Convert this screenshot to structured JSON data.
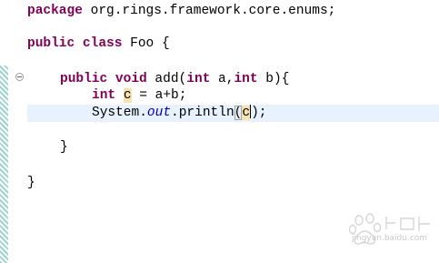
{
  "editor": {
    "language": "java",
    "lines": {
      "package_kw": "package",
      "package_name": " org.rings.framework.core.enums;",
      "class_public": "public",
      "class_kw": "class",
      "class_name": " Foo {",
      "method_public": "public",
      "method_void": "void",
      "method_sig1": " add(",
      "param_int1": "int",
      "method_sig2": " a,",
      "param_int2": "int",
      "method_sig3": " b){",
      "decl_int": "int",
      "decl_var": "c",
      "decl_rest": " = a+b;",
      "call_prefix": "System.",
      "call_field": "out",
      "call_method": ".println",
      "call_open": "(",
      "call_arg": "c",
      "call_close": ")",
      "call_end": ";",
      "method_close": "}",
      "class_close": "}"
    },
    "colors": {
      "keyword": "#7f0055",
      "field": "#0000c0",
      "current_line": "#e8f2fe",
      "occurrence": "#f7e4ad"
    }
  },
  "watermark": {
    "text": "jingyan.baidu.com"
  }
}
